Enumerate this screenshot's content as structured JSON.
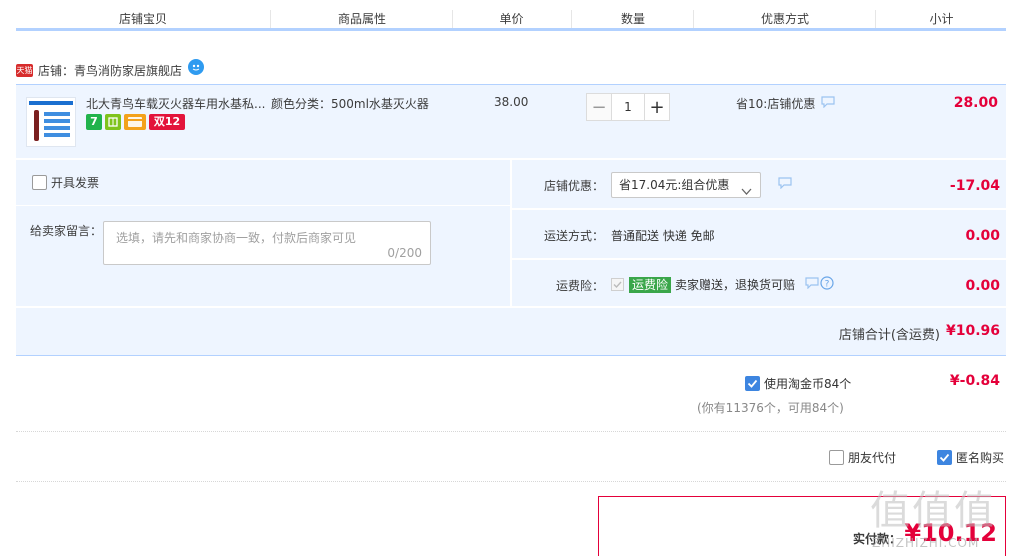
{
  "header": {
    "columns": [
      "店铺宝贝",
      "商品属性",
      "单价",
      "数量",
      "优惠方式",
      "小计"
    ]
  },
  "shop": {
    "badge": "天猫",
    "label": "店铺：青鸟消防家居旗舰店"
  },
  "item": {
    "title": "北大青鸟车载灭火器车用水基私...",
    "attribute": "颜色分类：500ml水基灭火器",
    "unit_price": "38.00",
    "quantity": "1",
    "qty_minus": "−",
    "qty_plus": "+",
    "discount": "省10:店铺优惠",
    "subtotal": "28.00",
    "service_tags": {
      "seven": "7",
      "double12": "双12"
    }
  },
  "options": {
    "invoice_label": "开具发票",
    "message_label": "给卖家留言：",
    "message_placeholder": "选填，请先和商家协商一致，付款后商家可见",
    "message_count": "0/200",
    "shop_discount_label": "店铺优惠：",
    "shop_discount_value": "省17.04元:组合优惠",
    "shop_discount_amount": "-17.04",
    "shipping_label": "运送方式：",
    "shipping_value": "普通配送 快递 免邮",
    "shipping_amount": "0.00",
    "insurance_label": "运费险：",
    "insurance_tag": "运费险",
    "insurance_text": "卖家赠送，退换货可赔",
    "insurance_amount": "0.00"
  },
  "shop_total": {
    "label": "店铺合计(含运费)",
    "amount": "¥10.96"
  },
  "coins": {
    "label": "使用淘金币84个",
    "note": "(你有11376个，可用84个)",
    "amount": "¥-0.84"
  },
  "payment": {
    "friend_pay": "朋友代付",
    "anonymous": "匿名购买"
  },
  "final": {
    "label": "实付款：",
    "amount": "¥10.12"
  },
  "watermark": {
    "big": "值值值",
    "small": "ZHIZHIZHI.COM"
  },
  "colors": {
    "accent_blue": "#b2d1ff",
    "row_bg": "#eef5ff",
    "price_red": "#e4003a",
    "checkbox_blue": "#3d85e0"
  }
}
